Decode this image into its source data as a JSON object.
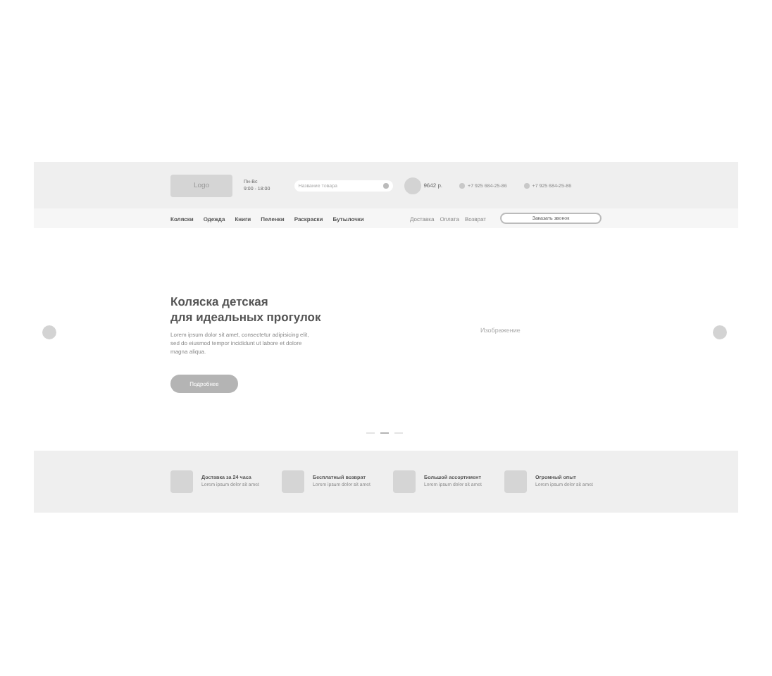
{
  "header": {
    "logo": "Logo",
    "hours": [
      "Пн-Вс",
      "9:00 - 18:00"
    ],
    "search": {
      "placeholder": "Название товара"
    },
    "cart_total": "9642 р.",
    "phones": [
      "+7 925 684-25-86",
      "+7 925 684-25-86"
    ]
  },
  "nav": {
    "categories": [
      "Коляски",
      "Одежда",
      "Книги",
      "Пеленки",
      "Раскраски",
      "Бутылочки"
    ],
    "links": [
      "Доставка",
      "Оплата",
      "Возврат"
    ],
    "callback_button": "Заказать звонок"
  },
  "hero": {
    "title": [
      "Коляска детская",
      "для идеальных прогулок"
    ],
    "text": "Lorem ipsum dolor sit amet, consectetur adipisicing elit, sed do eiusmod tempor incididunt ut labore et dolore magna aliqua.",
    "button": "Подробнее",
    "image_label": "Изображение",
    "slides": [
      {
        "selected": false
      },
      {
        "selected": true
      },
      {
        "selected": false
      }
    ]
  },
  "features": [
    {
      "title": "Доставка за 24 часа",
      "text": "Lorem ipsum dolor sit amet"
    },
    {
      "title": "Бесплатный возврат",
      "text": "Lorem ipsum dolor sit amet"
    },
    {
      "title": "Большой ассортимент",
      "text": "Lorem ipsum dolor sit amet"
    },
    {
      "title": "Огромный опыт",
      "text": "Lorem ipsum dolor sit amet"
    }
  ]
}
